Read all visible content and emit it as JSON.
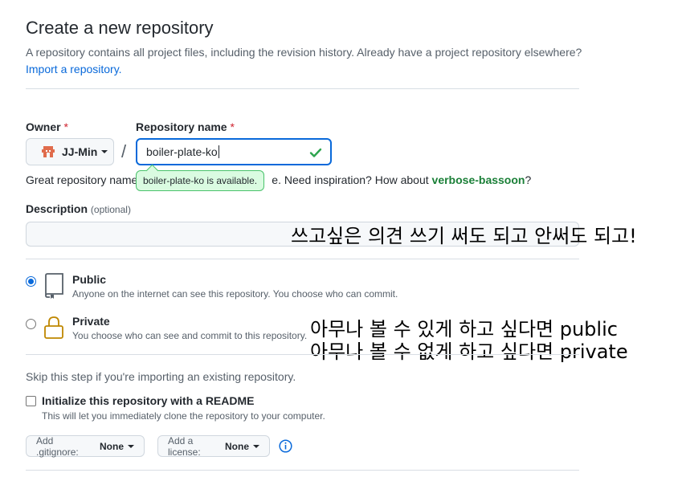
{
  "header": {
    "title": "Create a new repository",
    "subtitle": "A repository contains all project files, including the revision history. Already have a project repository elsewhere?",
    "import_link": "Import a repository."
  },
  "owner": {
    "label": "Owner",
    "required": "*",
    "value": "JJ-Min"
  },
  "separator": "/",
  "repository": {
    "label": "Repository name",
    "required": "*",
    "value": "boiler-plate-ko",
    "availability_tooltip": "boiler-plate-ko is available."
  },
  "name_hint": {
    "prefix": "Great repository names",
    "middle": "e. Need inspiration? How about",
    "suggestion": "verbose-bassoon",
    "suffix": "?"
  },
  "description": {
    "label": "Description",
    "optional": "(optional)",
    "value": ""
  },
  "annotations": {
    "description_note": "쓰고싶은 의견 쓰기 써도 되고 안써도 되고!",
    "visibility_note_line1": "아무나 볼 수 있게 하고 싶다면 public",
    "visibility_note_line2": "아무나 볼 수 없게 하고 싶다면 private"
  },
  "visibility": {
    "public": {
      "title": "Public",
      "description": "Anyone on the internet can see this repository. You choose who can commit.",
      "selected": true
    },
    "private": {
      "title": "Private",
      "description": "You choose who can see and commit to this repository.",
      "selected": false
    }
  },
  "init": {
    "skip_text": "Skip this step if you're importing an existing repository.",
    "readme_label": "Initialize this repository with a README",
    "readme_desc": "This will let you immediately clone the repository to your computer.",
    "readme_checked": false
  },
  "options": {
    "gitignore_label": "Add .gitignore:",
    "gitignore_value": "None",
    "license_label": "Add a license:",
    "license_value": "None"
  },
  "colors": {
    "accent": "#0969da",
    "success": "#1a7f37",
    "required": "#cf222e"
  }
}
